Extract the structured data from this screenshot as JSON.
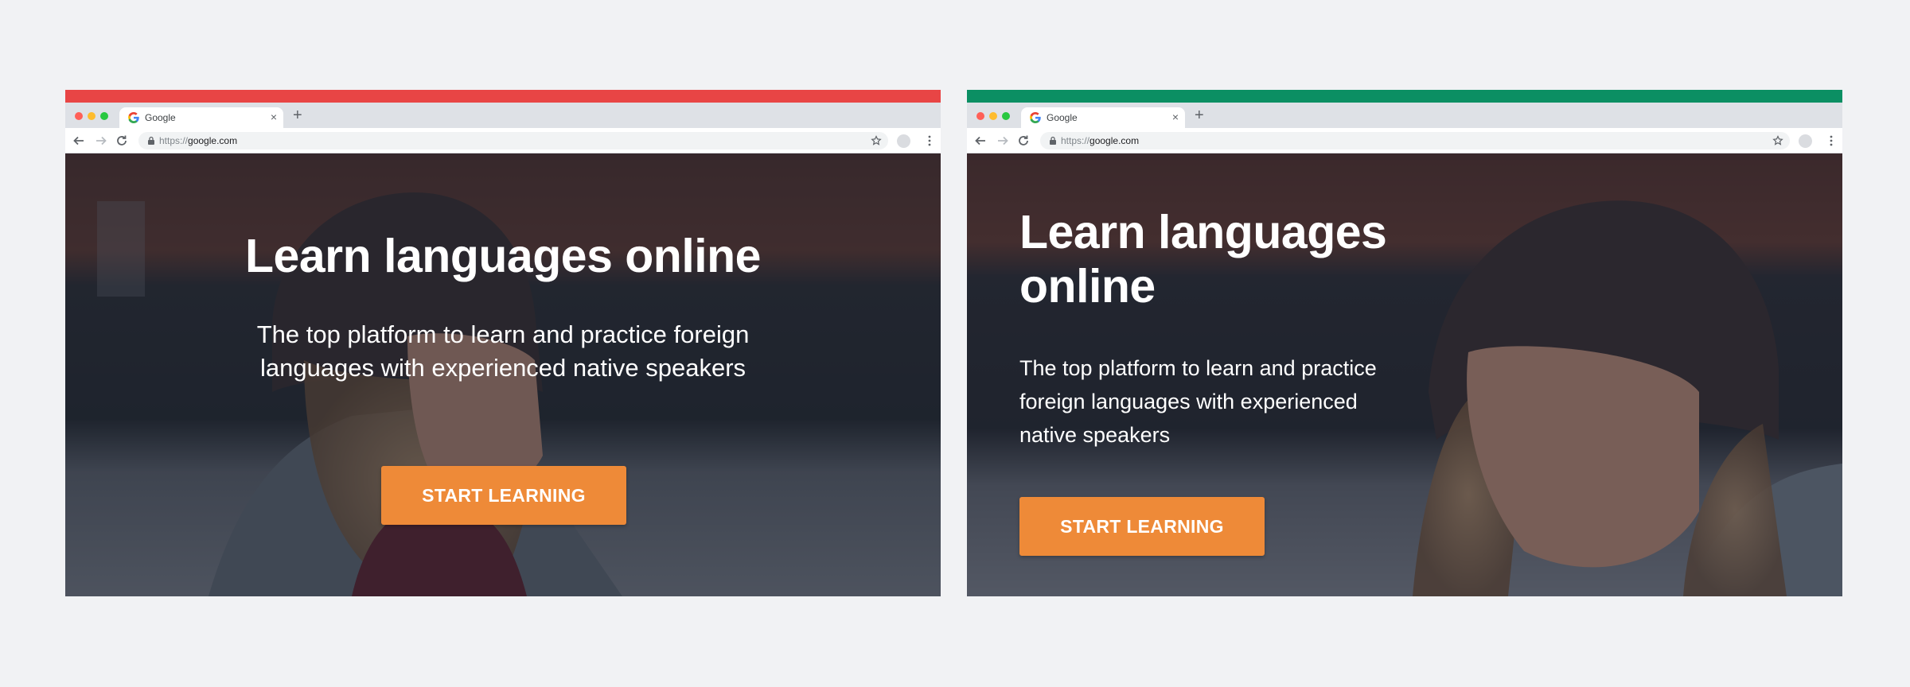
{
  "colors": {
    "page_background": "#f1f2f4",
    "variant_a_accent": "#e84545",
    "variant_b_accent": "#0b8f63",
    "cta_background": "#ee8a38",
    "cta_text": "#ffffff",
    "tabstrip": "#dee1e6"
  },
  "icons": {
    "window_controls": [
      "close-dot",
      "minimize-dot",
      "maximize-dot"
    ],
    "favicon": "google-g-icon",
    "tab_close": "close-icon",
    "new_tab": "plus-icon",
    "back": "arrow-left-icon",
    "forward": "arrow-right-icon",
    "reload": "reload-icon",
    "lock": "lock-icon",
    "bookmark": "star-icon",
    "profile": "avatar",
    "menu": "kebab-icon"
  },
  "mockups": [
    {
      "browser": {
        "tab_title": "Google",
        "tab_close": "×",
        "new_tab": "+",
        "url_scheme": "https://",
        "url_host": "google.com"
      },
      "hero": {
        "headline": "Learn languages online",
        "subline": "The top platform to learn and practice foreign languages with experienced native speakers",
        "cta_label": "START LEARNING",
        "layout": "centered"
      }
    },
    {
      "browser": {
        "tab_title": "Google",
        "tab_close": "×",
        "new_tab": "+",
        "url_scheme": "https://",
        "url_host": "google.com"
      },
      "hero": {
        "headline": "Learn languages online",
        "subline": "The top platform to learn and practice foreign languages with experienced native speakers",
        "cta_label": "START LEARNING",
        "layout": "left-aligned"
      }
    }
  ]
}
